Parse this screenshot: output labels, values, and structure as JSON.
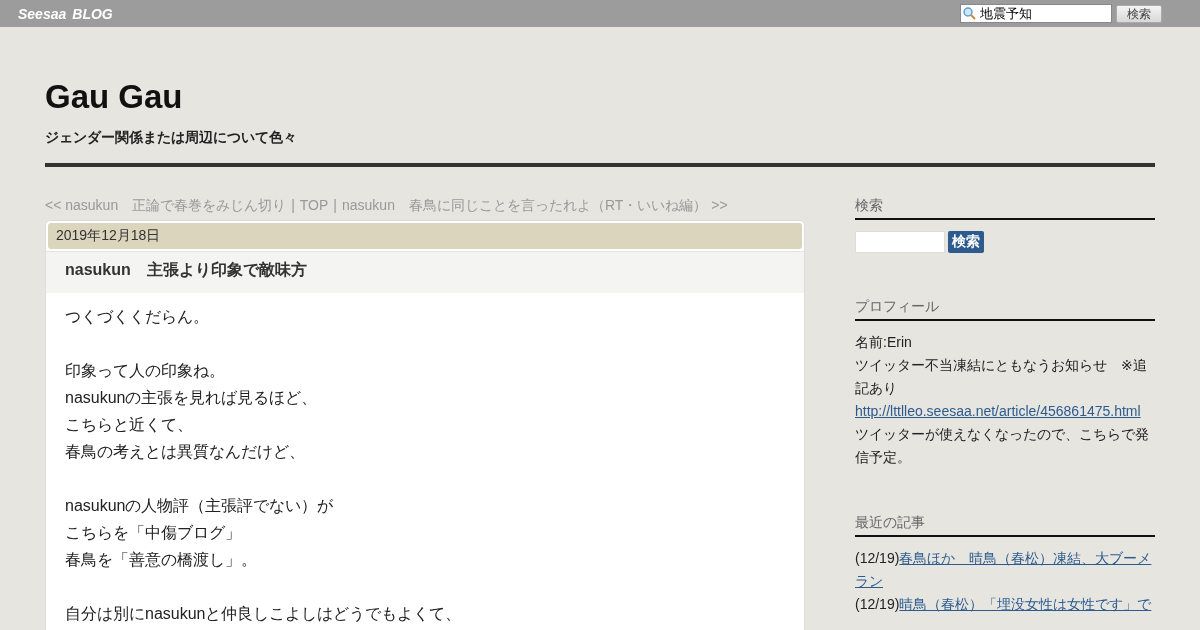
{
  "topbar": {
    "logo": "Seesaa",
    "logo_suffix": "BLOG",
    "search": {
      "value": "地震予知",
      "button": "検索"
    }
  },
  "blog": {
    "title": "Gau Gau",
    "subtitle": "ジェンダー関係または周辺について色々"
  },
  "nav": [
    {
      "kind": "link",
      "text": "<< nasukun　正論で春巻をみじん切り"
    },
    {
      "kind": "separator",
      "text": "|"
    },
    {
      "kind": "link",
      "text": "TOP"
    },
    {
      "kind": "separator",
      "text": "|"
    },
    {
      "kind": "link",
      "text": "nasukun　春鳥に同じことを言ったれよ（RT・いいね編） >>"
    }
  ],
  "article": {
    "date": "2019年12月18日",
    "title": "nasukun　主張より印象で敵味方",
    "paragraphs": [
      [
        "つくづくくだらん。"
      ],
      [
        "印象って人の印象ね。",
        "nasukunの主張を見れば見るほど、",
        "こちらと近くて、",
        "春鳥の考えとは異質なんだけど、"
      ],
      [
        "nasukunの人物評（主張評でない）が",
        "こちらを「中傷ブログ」",
        "春鳥を「善意の橋渡し」。"
      ],
      [
        "自分は別にnasukunと仲良しこよしはどうでもよくて、"
      ]
    ]
  },
  "sidebar": {
    "search": {
      "heading": "検索",
      "button": "検索"
    },
    "profile": {
      "heading": "プロフィール",
      "name": "名前:Erin",
      "notice": "ツイッター不当凍結にともなうお知らせ　※追記あり",
      "link": "http://lttlleo.seesaa.net/article/456861475.html",
      "note": "ツイッターが使えなくなったので、こちらで発信予定。"
    },
    "recent": {
      "heading": "最近の記事",
      "items": [
        {
          "date": "(12/19)",
          "title": "春鳥ほか　晴鳥（春松）凍結、大ブーメラン"
        },
        {
          "date": "(12/19)",
          "title": "晴鳥（春松）「埋没女性は女性です」で"
        }
      ]
    }
  }
}
